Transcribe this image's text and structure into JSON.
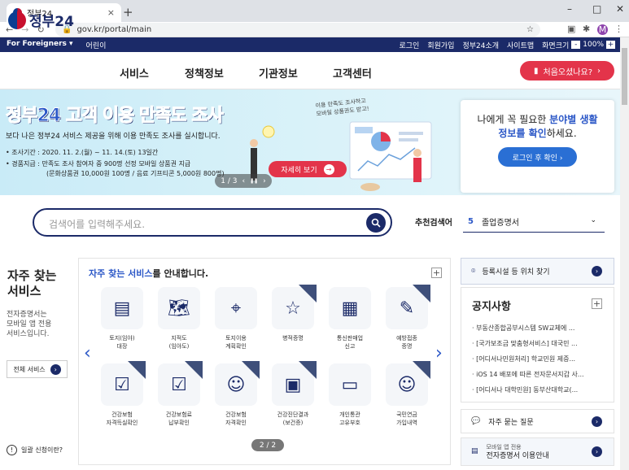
{
  "browser": {
    "tab_title": "정부24",
    "url": "gov.kr/portal/main",
    "avatar": "M",
    "new_tab": "+",
    "minimize": "–",
    "maximize": "□",
    "close": "✕",
    "tab_close": "×"
  },
  "util": {
    "foreigners": "For Foreigners ▾",
    "kids": "어린이",
    "links": [
      "로그인",
      "회원가입",
      "정부24소개",
      "사이트맵"
    ],
    "zoom_label": "화면크기",
    "zoom_value": "100%",
    "zoom_minus": "-",
    "zoom_plus": "+"
  },
  "gnb": {
    "logo": "정부24",
    "menus": [
      "서비스",
      "정책정보",
      "기관정보",
      "고객센터"
    ],
    "first_visit": "처음오셨나요?",
    "first_visit_arrow": "›"
  },
  "banner": {
    "title": "정부24 고객 이용 만족도 조사",
    "subtitle": "보다 나은 정부24 서비스 제공을 위해 이용 만족도 조사를 실시합니다.",
    "period": "• 조사기간 : 2020. 11. 2.(월) ~ 11. 14.(토) 13일간",
    "reward": "• 경품지급 : 만족도 조사 참여자 중 900명 선정 모바일 상품권 지급",
    "reward_detail": "(문화상품권 10,000원 100명 / 음료 기프티콘 5,000원 800명)",
    "hand_note_1": "이용 만족도 조사하고",
    "hand_note_2": "모바일 상품권도 받고!",
    "detail_button": "자세히 보기",
    "pager": "1 / 3",
    "pager_prev": "‹",
    "pager_pause": "❚❚",
    "pager_next": "›"
  },
  "login_card": {
    "line1_pre": "나에게 꼭 필요한 ",
    "line1_hl": "분야별 생활",
    "line2_hl": "정보를 확인",
    "line2_post": "하세요.",
    "button": "로그인 후 확인 ›"
  },
  "search": {
    "placeholder": "검색어를 입력해주세요.",
    "rec_label": "추천검색어",
    "rec_num": "5",
    "rec_term": "졸업증명서",
    "rec_chev": "⌄"
  },
  "left_panel": {
    "title_1": "자주 찾는",
    "title_2": "서비스",
    "desc_1": "전자증명서는",
    "desc_2": "모바일 앱 전용",
    "desc_3": "서비스입니다.",
    "all_button": "전체 서비스",
    "who_request": "일괄 신청이란?",
    "q": "!"
  },
  "center_panel": {
    "title_hl": "자주 찾는 서비스",
    "title_rest": "를 안내합니다.",
    "plus": "+",
    "prev": "‹",
    "next": "›",
    "pager": "2 / 2",
    "row1": [
      {
        "icon": "▤",
        "l1": "토지(임야)",
        "l2": "대장",
        "rib": false
      },
      {
        "icon": "🗺",
        "l1": "지적도",
        "l2": "(임야도)",
        "rib": false
      },
      {
        "icon": "⌖",
        "l1": "토지이용",
        "l2": "계획확인",
        "rib": false
      },
      {
        "icon": "☆",
        "l1": "병적증명",
        "l2": "",
        "rib": true
      },
      {
        "icon": "▦",
        "l1": "통신판매업",
        "l2": "신고",
        "rib": false
      },
      {
        "icon": "✎",
        "l1": "예방접종",
        "l2": "증명",
        "rib": true
      }
    ],
    "row2": [
      {
        "icon": "☑",
        "l1": "건강보험",
        "l2": "자격득실확인",
        "rib": true
      },
      {
        "icon": "☑",
        "l1": "건강보험료",
        "l2": "납부확인",
        "rib": true
      },
      {
        "icon": "☺",
        "l1": "건강보험",
        "l2": "자격확인",
        "rib": true
      },
      {
        "icon": "▣",
        "l1": "건강진단결과",
        "l2": "(보건증)",
        "rib": true
      },
      {
        "icon": "▭",
        "l1": "개인통관",
        "l2": "고유부호",
        "rib": false
      },
      {
        "icon": "☺",
        "l1": "국민연금",
        "l2": "가입내역",
        "rib": true
      }
    ]
  },
  "right": {
    "find_facility": "등록시설 등 위치 찾기",
    "notice_title": "공지사항",
    "notice_plus": "+",
    "notices": [
      "부동산종합공부시스템 SW교체에 ...",
      "[국가보조금 맞춤형서비스] 대국민 ...",
      "[어디서나민원처리] 학교민원 제증...",
      "iOS 14 배포에 따른 전자문서지갑 사...",
      "[어디서나 대학민원] 동부산대학교(..."
    ],
    "faq": "자주 묻는 질문",
    "mobile_1": "모바일 앱 전용",
    "mobile_2": "전자증명서 이용안내",
    "go": "›"
  },
  "colors": {
    "navy": "#1b2a68",
    "blue": "#2b57c7",
    "red": "#e3344a"
  }
}
